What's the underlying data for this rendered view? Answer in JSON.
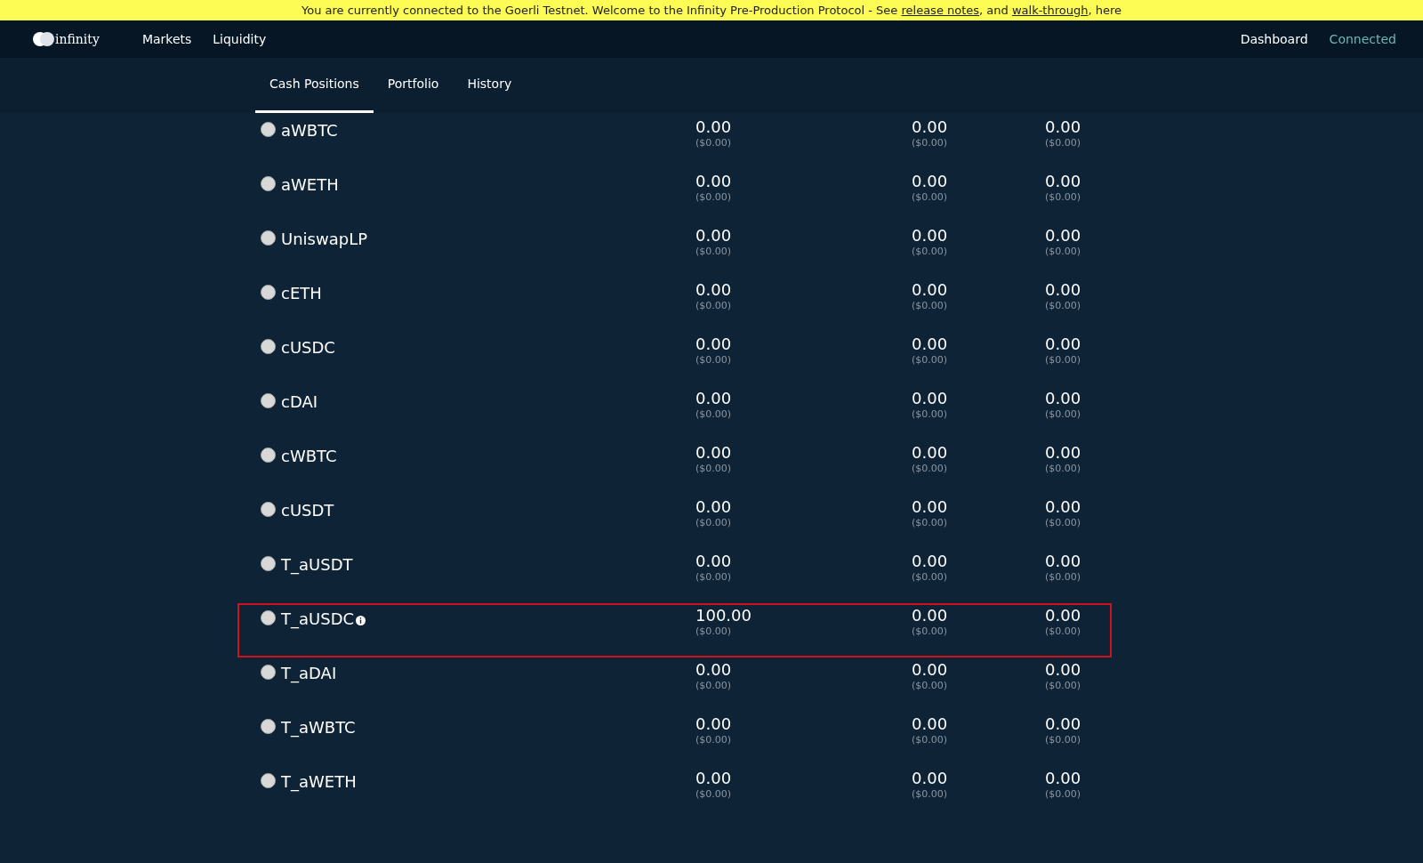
{
  "banner": {
    "text": "You are currently connected to the Goerli Testnet. Welcome to the Infinity Pre-Production Protocol - See ",
    "links": [
      "release notes",
      "walk-through"
    ],
    "joiner": ", and ",
    "tail": ", here"
  },
  "navbar": {
    "brand": "infinity",
    "links": [
      "Markets",
      "Liquidity"
    ],
    "right": [
      {
        "label": "Dashboard",
        "kind": "link"
      },
      {
        "label": "Connected",
        "kind": "status"
      }
    ]
  },
  "tabs": [
    {
      "label": "Cash Positions",
      "selected": true
    },
    {
      "label": "Portfolio",
      "selected": false
    },
    {
      "label": "History",
      "selected": false
    }
  ],
  "rows": [
    {
      "name": "aWBTC",
      "selected": false,
      "highlighted": false,
      "info": false,
      "values": [
        {
          "amount": "0.00",
          "usd": "($0.00)"
        },
        {
          "amount": "0.00",
          "usd": "($0.00)"
        },
        {
          "amount": "0.00",
          "usd": "($0.00)"
        }
      ]
    },
    {
      "name": "aWETH",
      "selected": false,
      "highlighted": false,
      "info": false,
      "values": [
        {
          "amount": "0.00",
          "usd": "($0.00)"
        },
        {
          "amount": "0.00",
          "usd": "($0.00)"
        },
        {
          "amount": "0.00",
          "usd": "($0.00)"
        }
      ]
    },
    {
      "name": "UniswapLP",
      "selected": false,
      "highlighted": false,
      "info": false,
      "values": [
        {
          "amount": "0.00",
          "usd": "($0.00)"
        },
        {
          "amount": "0.00",
          "usd": "($0.00)"
        },
        {
          "amount": "0.00",
          "usd": "($0.00)"
        }
      ]
    },
    {
      "name": "cETH",
      "selected": false,
      "highlighted": false,
      "info": false,
      "values": [
        {
          "amount": "0.00",
          "usd": "($0.00)"
        },
        {
          "amount": "0.00",
          "usd": "($0.00)"
        },
        {
          "amount": "0.00",
          "usd": "($0.00)"
        }
      ]
    },
    {
      "name": "cUSDC",
      "selected": false,
      "highlighted": false,
      "info": false,
      "values": [
        {
          "amount": "0.00",
          "usd": "($0.00)"
        },
        {
          "amount": "0.00",
          "usd": "($0.00)"
        },
        {
          "amount": "0.00",
          "usd": "($0.00)"
        }
      ]
    },
    {
      "name": "cDAI",
      "selected": false,
      "highlighted": false,
      "info": false,
      "values": [
        {
          "amount": "0.00",
          "usd": "($0.00)"
        },
        {
          "amount": "0.00",
          "usd": "($0.00)"
        },
        {
          "amount": "0.00",
          "usd": "($0.00)"
        }
      ]
    },
    {
      "name": "cWBTC",
      "selected": false,
      "highlighted": false,
      "info": false,
      "values": [
        {
          "amount": "0.00",
          "usd": "($0.00)"
        },
        {
          "amount": "0.00",
          "usd": "($0.00)"
        },
        {
          "amount": "0.00",
          "usd": "($0.00)"
        }
      ]
    },
    {
      "name": "cUSDT",
      "selected": false,
      "highlighted": false,
      "info": false,
      "values": [
        {
          "amount": "0.00",
          "usd": "($0.00)"
        },
        {
          "amount": "0.00",
          "usd": "($0.00)"
        },
        {
          "amount": "0.00",
          "usd": "($0.00)"
        }
      ]
    },
    {
      "name": "T_aUSDT",
      "selected": false,
      "highlighted": false,
      "info": false,
      "values": [
        {
          "amount": "0.00",
          "usd": "($0.00)"
        },
        {
          "amount": "0.00",
          "usd": "($0.00)"
        },
        {
          "amount": "0.00",
          "usd": "($0.00)"
        }
      ]
    },
    {
      "name": "T_aUSDC",
      "selected": false,
      "highlighted": true,
      "info": true,
      "values": [
        {
          "amount": "100.00",
          "usd": "($0.00)"
        },
        {
          "amount": "0.00",
          "usd": "($0.00)"
        },
        {
          "amount": "0.00",
          "usd": "($0.00)"
        }
      ]
    },
    {
      "name": "T_aDAI",
      "selected": false,
      "highlighted": false,
      "info": false,
      "values": [
        {
          "amount": "0.00",
          "usd": "($0.00)"
        },
        {
          "amount": "0.00",
          "usd": "($0.00)"
        },
        {
          "amount": "0.00",
          "usd": "($0.00)"
        }
      ]
    },
    {
      "name": "T_aWBTC",
      "selected": false,
      "highlighted": false,
      "info": false,
      "values": [
        {
          "amount": "0.00",
          "usd": "($0.00)"
        },
        {
          "amount": "0.00",
          "usd": "($0.00)"
        },
        {
          "amount": "0.00",
          "usd": "($0.00)"
        }
      ]
    },
    {
      "name": "T_aWETH",
      "selected": false,
      "highlighted": false,
      "info": false,
      "values": [
        {
          "amount": "0.00",
          "usd": "($0.00)"
        },
        {
          "amount": "0.00",
          "usd": "($0.00)"
        },
        {
          "amount": "0.00",
          "usd": "($0.00)"
        }
      ]
    }
  ]
}
